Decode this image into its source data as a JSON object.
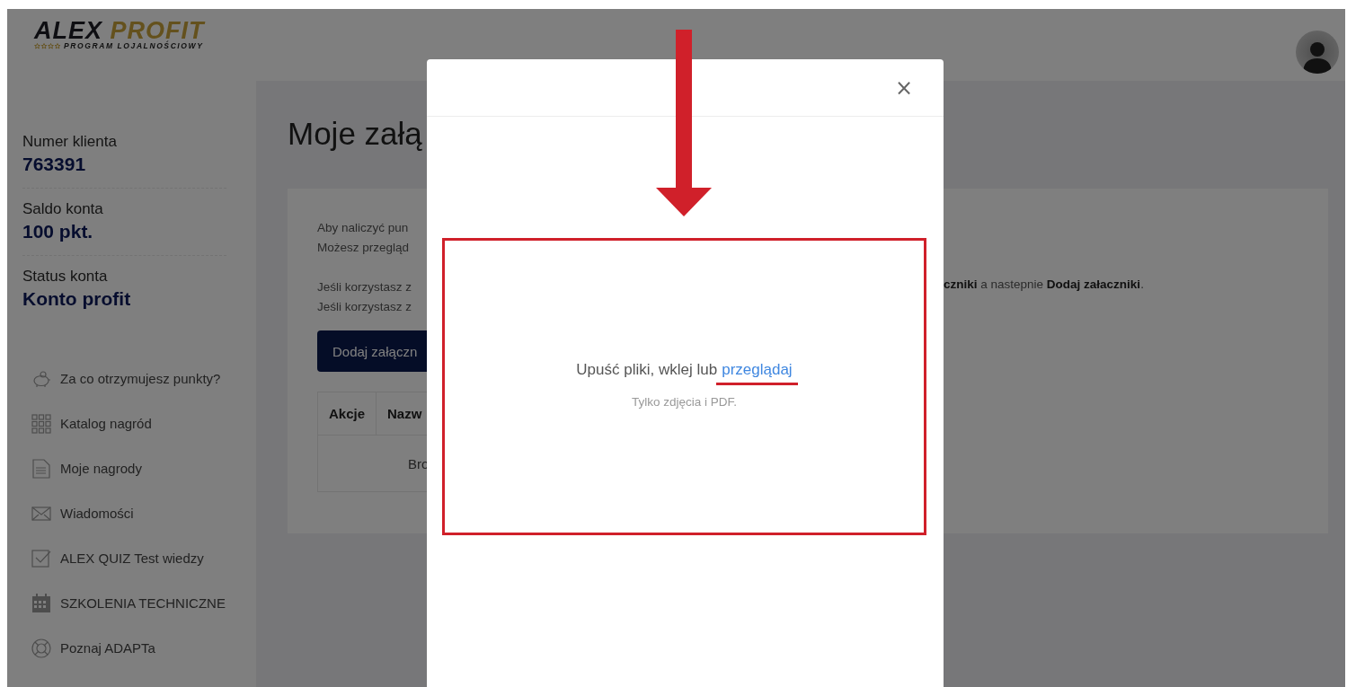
{
  "logo": {
    "brand": "ALEX",
    "brand_accent": "PROFIT",
    "tagline": "PROGRAM LOJALNOŚCIOWY"
  },
  "account": [
    {
      "label": "Numer klienta",
      "value": "763391"
    },
    {
      "label": "Saldo konta",
      "value": "100 pkt."
    },
    {
      "label": "Status konta",
      "value": "Konto profit"
    }
  ],
  "nav": [
    {
      "kind": "piggy-bank",
      "label": "Za co otrzymujesz punkty?"
    },
    {
      "kind": "grid",
      "label": "Katalog nagród"
    },
    {
      "kind": "document",
      "label": "Moje nagrody"
    },
    {
      "kind": "envelope",
      "label": "Wiadomości"
    },
    {
      "kind": "checkbox",
      "label": "ALEX QUIZ Test wiedzy"
    },
    {
      "kind": "calendar",
      "label": "SZKOLENIA TECHNICZNE"
    },
    {
      "kind": "lifebuoy",
      "label": "Poznaj ADAPTa"
    }
  ],
  "page": {
    "title": "Moje załą",
    "intro": [
      "Aby naliczyć pun",
      "Możesz przegląd"
    ],
    "instructions": [
      "Jeśli korzystasz z",
      "Jeśli korzystasz z"
    ],
    "instructions_tail": "**czniki** a nastepnie **Dodaj załaczniki**.",
    "add_button": "Dodaj załączn",
    "table": {
      "columns": [
        "Akcje",
        "Nazw"
      ],
      "empty_message": "Bro"
    }
  },
  "modal": {
    "close": "×",
    "drop_text": "Upuść pliki, wklej lub",
    "browse_link": "przeglądaj",
    "hint": "Tylko zdjęcia i PDF."
  }
}
